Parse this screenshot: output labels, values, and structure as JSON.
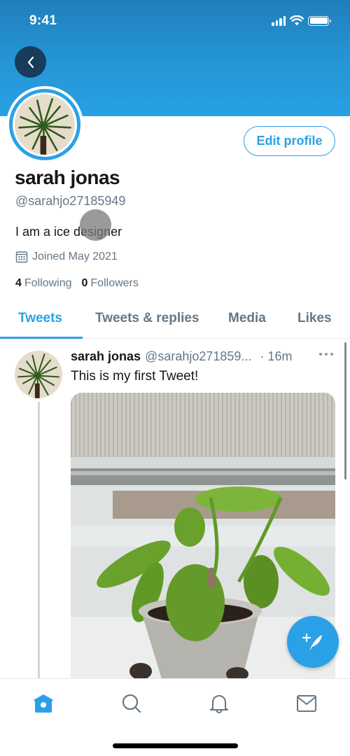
{
  "status_bar": {
    "time": "9:41",
    "icons": [
      "cellular-signal-icon",
      "wifi-icon",
      "battery-icon"
    ]
  },
  "header": {
    "back_icon": "chevron-left-icon",
    "banner_color": "#2596d6"
  },
  "profile": {
    "avatar_icon": "plant-photo",
    "edit_profile_label": "Edit profile",
    "display_name": "sarah jonas",
    "handle": "@sarahjo27185949",
    "bio": "I am a ice designer",
    "joined_icon": "calendar-icon",
    "joined": "Joined May 2021",
    "following_count": "4",
    "following_label": "Following",
    "followers_count": "0",
    "followers_label": "Followers"
  },
  "tabs": [
    {
      "label": "Tweets",
      "active": true
    },
    {
      "label": "Tweets & replies",
      "active": false
    },
    {
      "label": "Media",
      "active": false
    },
    {
      "label": "Likes",
      "active": false
    }
  ],
  "tweets": [
    {
      "name": "sarah jonas",
      "handle": "@sarahjo271859...",
      "time": "· 16m",
      "text": "This is my first Tweet!",
      "more_icon": "ellipsis-icon",
      "media": "potted-plant-photo"
    }
  ],
  "compose_button": {
    "icon": "compose-tweet-icon"
  },
  "bottom_nav": [
    {
      "name": "home",
      "icon": "home-icon",
      "active": true
    },
    {
      "name": "search",
      "icon": "search-icon",
      "active": false
    },
    {
      "name": "notifications",
      "icon": "bell-icon",
      "active": false
    },
    {
      "name": "messages",
      "icon": "mail-icon",
      "active": false
    }
  ],
  "colors": {
    "accent": "#2aa1e6",
    "secondary_text": "#657786",
    "primary_text": "#14171a",
    "back_button": "#173c5c"
  }
}
